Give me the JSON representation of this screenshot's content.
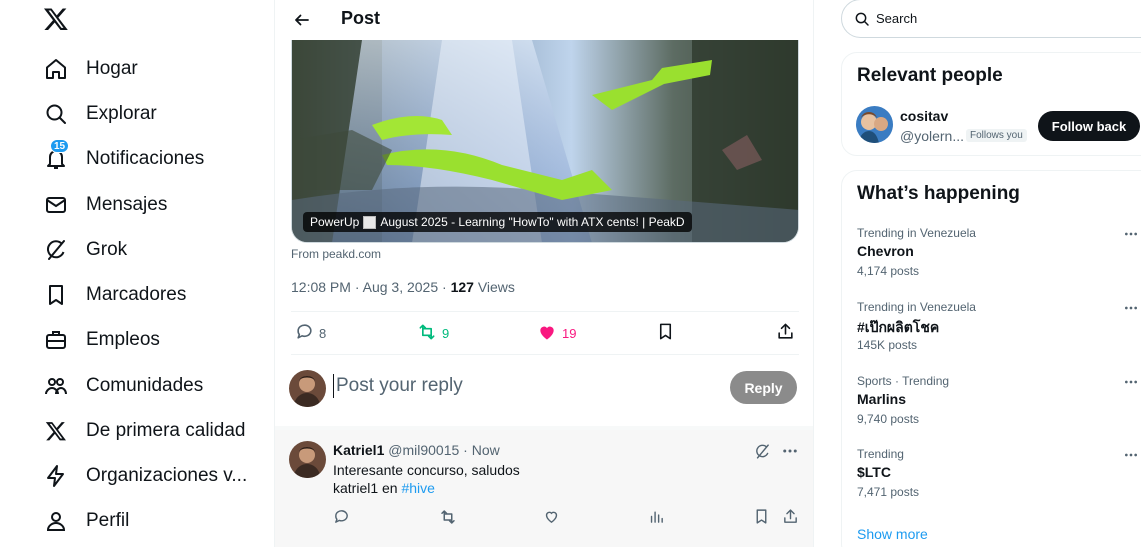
{
  "nav": {
    "items": [
      {
        "label": "Hogar",
        "icon": "home-icon"
      },
      {
        "label": "Explorar",
        "icon": "search-icon"
      },
      {
        "label": "Notificaciones",
        "icon": "bell-icon",
        "badge": "15"
      },
      {
        "label": "Mensajes",
        "icon": "envelope-icon"
      },
      {
        "label": "Grok",
        "icon": "grok-icon"
      },
      {
        "label": "Marcadores",
        "icon": "bookmark-icon"
      },
      {
        "label": "Empleos",
        "icon": "briefcase-icon"
      },
      {
        "label": "Comunidades",
        "icon": "people-icon"
      },
      {
        "label": "De primera calidad",
        "icon": "x-logo-icon"
      },
      {
        "label": "Organizaciones v...",
        "icon": "lightning-icon"
      },
      {
        "label": "Perfil",
        "icon": "person-icon"
      }
    ]
  },
  "post": {
    "header_title": "Post",
    "media_caption_prefix": "PowerUp",
    "media_caption": "August 2025 - Learning \"HowTo\" with ATX cents! | PeakD",
    "from_source": "From peakd.com",
    "time": "12:08 PM",
    "date": "Aug 3, 2025",
    "views_count": "127",
    "views_label": "Views",
    "replies": "8",
    "reposts": "9",
    "likes": "19"
  },
  "reply": {
    "placeholder": "Post your reply",
    "button": "Reply"
  },
  "comment": {
    "name": "Katriel1",
    "handle": "@mil90015",
    "time": "Now",
    "line1": "Interesante concurso, saludos",
    "line2_prefix": "katriel1 en",
    "hashtag": "#hive"
  },
  "right": {
    "search_placeholder": "Search",
    "relevant_title": "Relevant people",
    "person": {
      "name": "cositav",
      "handle": "@yolern...",
      "follows_you": "Follows you",
      "follow_button": "Follow back"
    },
    "happening_title": "What’s happening",
    "trends": [
      {
        "context": "Trending in Venezuela",
        "name": "Chevron",
        "count": "4,174 posts"
      },
      {
        "context": "Trending in Venezuela",
        "name": "#เป๊กผลิตโชค",
        "count": "145K posts"
      },
      {
        "context": "Sports · Trending",
        "name": "Marlins",
        "count": "9,740 posts"
      },
      {
        "context": "Trending",
        "name": "$LTC",
        "count": "7,471 posts"
      }
    ],
    "show_more": "Show more"
  },
  "colors": {
    "accent": "#1d9bf0",
    "repost": "#00ba7c",
    "like": "#f91880",
    "text": "#0f1419",
    "muted": "#536471"
  }
}
